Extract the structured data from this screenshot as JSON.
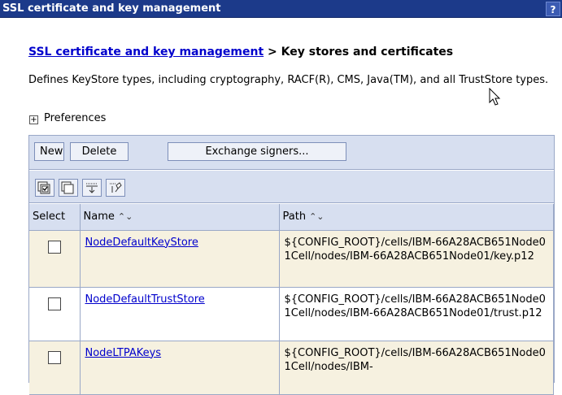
{
  "window": {
    "title": "SSL certificate and key management",
    "help_label": "?"
  },
  "breadcrumb": {
    "link": "SSL certificate and key management",
    "separator": " > ",
    "current": "Key stores and certificates"
  },
  "description": "Defines KeyStore types, including cryptography, RACF(R), CMS, Java(TM), and all TrustStore types.",
  "preferences": {
    "expander": "+",
    "label": "Preferences"
  },
  "buttons": {
    "new": "New",
    "delete": "Delete",
    "exchange": "Exchange signers..."
  },
  "toolbar_icons": [
    "select-all-icon",
    "deselect-all-icon",
    "show-filter-icon",
    "clear-filter-icon"
  ],
  "table": {
    "columns": [
      "Select",
      "Name",
      "Path"
    ],
    "sort_indicator": "⌃⌄",
    "rows": [
      {
        "name": "NodeDefaultKeyStore",
        "path": "${CONFIG_ROOT}/cells/IBM-66A28ACB651Node01Cell/nodes/IBM-66A28ACB651Node01/key.p12"
      },
      {
        "name": "NodeDefaultTrustStore",
        "path": "${CONFIG_ROOT}/cells/IBM-66A28ACB651Node01Cell/nodes/IBM-66A28ACB651Node01/trust.p12"
      },
      {
        "name": "NodeLTPAKeys",
        "path": "${CONFIG_ROOT}/cells/IBM-66A28ACB651Node01Cell/nodes/IBM-"
      }
    ]
  },
  "colors": {
    "titlebar": "#1c3a8a",
    "toolbar": "#d7dff0",
    "row_alt": "#f6f1e0",
    "link": "#0000cc"
  }
}
